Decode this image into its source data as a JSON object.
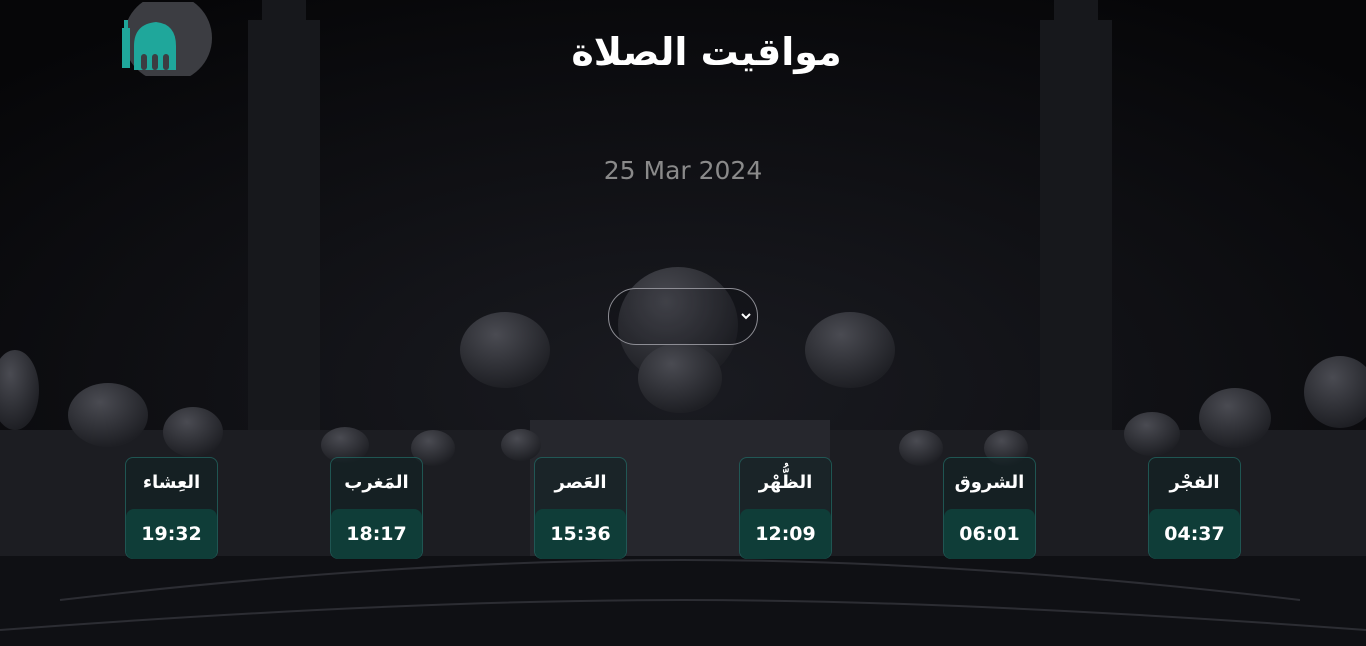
{
  "header": {
    "title": "مواقيت الصلاة"
  },
  "date": "25 Mar 2024",
  "city_select": {
    "value": ""
  },
  "prayers": [
    {
      "name": "العِشاء",
      "time": "19:32"
    },
    {
      "name": "المَغرب",
      "time": "18:17"
    },
    {
      "name": "العَصر",
      "time": "15:36"
    },
    {
      "name": "الظُّهْر",
      "time": "12:09"
    },
    {
      "name": "الشروق",
      "time": "06:01"
    },
    {
      "name": "الفجْر",
      "time": "04:37"
    }
  ],
  "colors": {
    "accent": "#1fa79b",
    "card_time_bg": "#0f3d38",
    "date_text": "#8a8a8a"
  },
  "icons": {
    "logo": "mosque-icon",
    "select": "chevron-down-icon"
  }
}
